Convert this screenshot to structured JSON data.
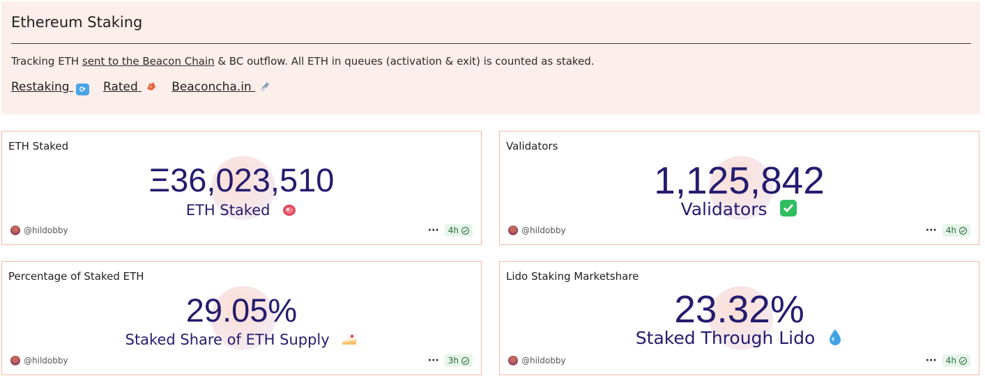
{
  "header": {
    "title": "Ethereum Staking",
    "desc_prefix": "Tracking ETH ",
    "desc_link": "sent to the Beacon Chain",
    "desc_suffix": " & BC outflow. All ETH in queues (activation & exit) is counted as staked.",
    "links": [
      {
        "label": "Restaking",
        "icon": "repeat-emoji-icon"
      },
      {
        "label": "Rated",
        "icon": "meat-emoji-icon"
      },
      {
        "label": "Beaconcha.in",
        "icon": "satellite-emoji-icon"
      }
    ]
  },
  "cards": [
    {
      "title": "ETH Staked",
      "value": "Ξ36,023,510",
      "subtitle": "ETH Staked",
      "emoji": "cut-of-meat-icon",
      "author": "@hildobby",
      "age": "4h"
    },
    {
      "title": "Validators",
      "value": "1,125,842",
      "subtitle": "Validators",
      "emoji": "check-mark-button-icon",
      "author": "@hildobby",
      "age": "4h"
    },
    {
      "title": "Percentage of Staked ETH",
      "value": "29.05%",
      "subtitle": "Staked Share of ETH Supply",
      "emoji": "shortcake-icon",
      "author": "@hildobby",
      "age": "3h"
    },
    {
      "title": "Lido Staking Marketshare",
      "value": "23.32%",
      "subtitle": "Staked Through Lido",
      "emoji": "droplet-icon",
      "author": "@hildobby",
      "age": "4h"
    }
  ],
  "colors": {
    "accent_text": "#241c6e",
    "header_bg": "#fceeea",
    "card_border": "#f0b8a6",
    "fresh_badge_bg": "#e6f5ea"
  }
}
